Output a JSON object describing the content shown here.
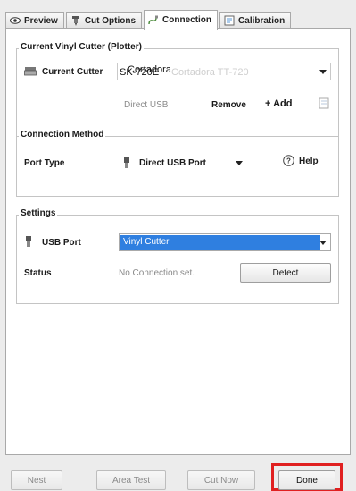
{
  "tabs": [
    {
      "label": "Preview",
      "icon": "eye-icon"
    },
    {
      "label": "Cut Options",
      "icon": "knife-icon"
    },
    {
      "label": "Connection",
      "icon": "cable-icon"
    },
    {
      "label": "Calibration",
      "icon": "calibration-icon"
    }
  ],
  "current_cutter": {
    "group_title": "Current Vinyl Cutter (Plotter)",
    "label": "Current Cutter",
    "value_front": "SK-720E",
    "value_overlay": "Cortadora",
    "value_ghost": "Cortadora TT-720",
    "connection_text": "Direct USB",
    "remove_label": "Remove",
    "add_label": "+ Add"
  },
  "connection_method": {
    "group_title": "Connection Method",
    "port_type_label": "Port Type",
    "port_type_value": "Direct USB Port",
    "help_label": "Help"
  },
  "settings": {
    "group_title": "Settings",
    "usb_port_label": "USB Port",
    "usb_port_value": "Vinyl Cutter",
    "status_label": "Status",
    "status_value": "No Connection set.",
    "detect_label": "Detect"
  },
  "footer": {
    "nest_label": "Nest",
    "area_test_label": "Area Test",
    "cut_now_label": "Cut Now",
    "done_label": "Done"
  },
  "colors": {
    "selection_blue": "#2f7fe0",
    "highlight_red": "#e02020"
  }
}
